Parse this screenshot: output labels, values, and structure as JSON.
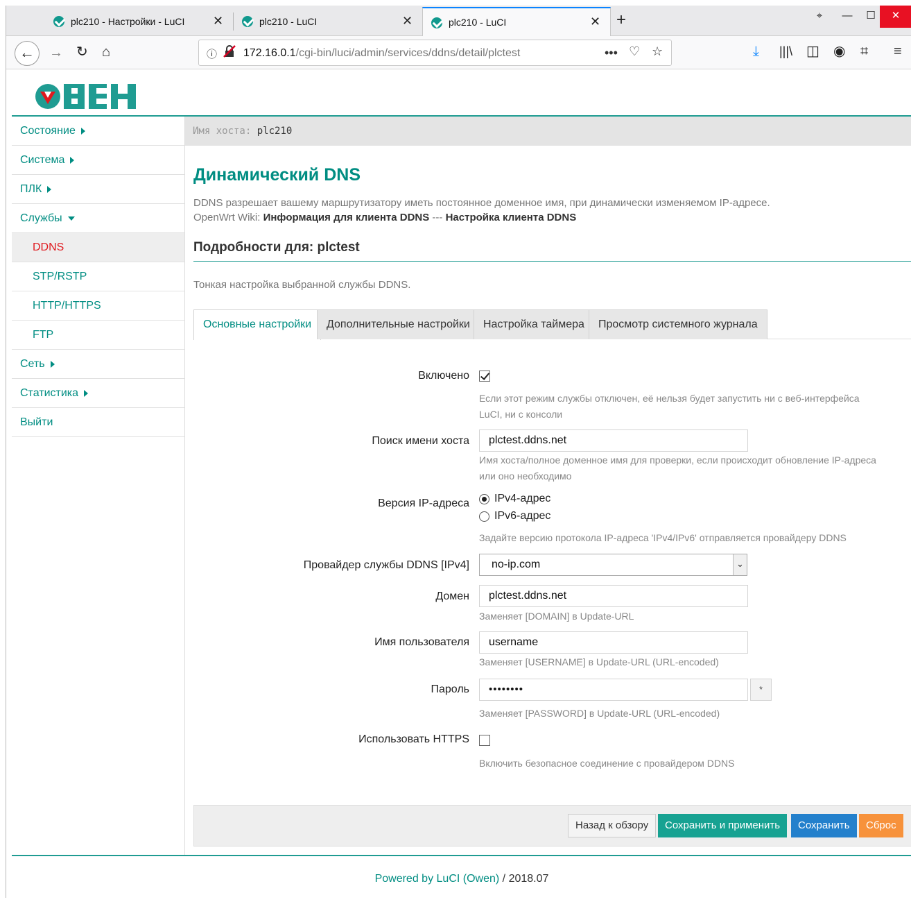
{
  "browser": {
    "tabs": [
      {
        "title": "plc210 - Настройки - LuCI"
      },
      {
        "title": "plc210 - LuCI"
      },
      {
        "title": "plc210 - LuCI"
      }
    ],
    "url_host": "172.16.0.1",
    "url_path": "/cgi-bin/luci/admin/services/ddns/detail/plctest"
  },
  "brand": {
    "logo": "ОВЕН",
    "accent": "#1f9c92",
    "link": "#008d82",
    "active": "#e0191e"
  },
  "sidebar": {
    "items": [
      {
        "label": "Состояние"
      },
      {
        "label": "Система"
      },
      {
        "label": "ПЛК"
      },
      {
        "label": "Службы"
      },
      {
        "label": "DDNS"
      },
      {
        "label": "STP/RSTP"
      },
      {
        "label": "HTTP/HTTPS"
      },
      {
        "label": "FTP"
      },
      {
        "label": "Сеть"
      },
      {
        "label": "Статистика"
      },
      {
        "label": "Выйти"
      }
    ]
  },
  "hostbar": {
    "prefix": "Имя хоста:",
    "value": "plc210"
  },
  "main": {
    "title": "Динамический DNS",
    "desc": "DDNS разрешает вашему маршрутизатору иметь постоянное доменное имя, при динамически изменяемом IP-адресе.",
    "wiki_prefix": "OpenWrt Wiki:",
    "wiki_link1": "Информация для клиента DDNS",
    "wiki_sep": "---",
    "wiki_link2": "Настройка клиента DDNS",
    "section_title": "Подробности для: plctest",
    "section_desc": "Тонкая настройка выбранной службы DDNS.",
    "tabs": [
      {
        "label": "Основные настройки"
      },
      {
        "label": "Дополнительные настройки"
      },
      {
        "label": "Настройка таймера"
      },
      {
        "label": "Просмотр системного журнала"
      }
    ]
  },
  "form": {
    "enabled": {
      "label": "Включено",
      "hint1": "Если этот режим службы отключен, её нельзя будет запустить ни с веб-интерфейса",
      "hint2": "LuCI, ни с консоли"
    },
    "lookup_host": {
      "label": "Поиск имени хоста",
      "value": "plctest.ddns.net",
      "hint1": "Имя хоста/полное доменное имя для проверки, если происходит обновление IP-адреса",
      "hint2": "или оно необходимо"
    },
    "ip_version": {
      "label": "Версия IP-адреса",
      "opt1": "IPv4-адрес",
      "opt2": "IPv6-адрес",
      "hint": "Задайте версию протокола IP-адреса 'IPv4/IPv6' отправляется провайдеру DDNS"
    },
    "provider": {
      "label": "Провайдер службы DDNS [IPv4]",
      "value": "no-ip.com"
    },
    "domain": {
      "label": "Домен",
      "value": "plctest.ddns.net",
      "hint": "Заменяет [DOMAIN] в Update-URL"
    },
    "username": {
      "label": "Имя пользователя",
      "value": "username",
      "hint": "Заменяет [USERNAME] в Update-URL (URL-encoded)"
    },
    "password": {
      "label": "Пароль",
      "value": "••••••••",
      "reveal": "*",
      "hint": "Заменяет [PASSWORD] в Update-URL (URL-encoded)"
    },
    "https": {
      "label": "Использовать HTTPS",
      "hint": "Включить безопасное соединение с провайдером DDNS"
    }
  },
  "actions": {
    "back": "Назад к обзору",
    "save_apply": "Сохранить и применить",
    "save": "Сохранить",
    "reset": "Сброс"
  },
  "footer": {
    "link": "Powered by LuCI (Owen)",
    "version": "/ 2018.07"
  }
}
